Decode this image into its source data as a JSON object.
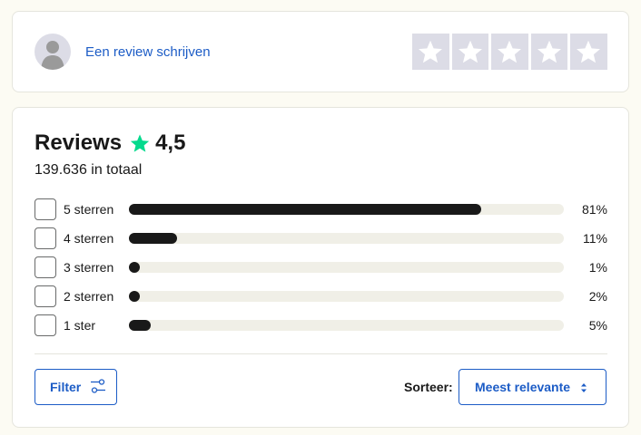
{
  "write_review": {
    "link_text": "Een review schrijven",
    "avatar_icon": "user-avatar-icon",
    "star_icon": "star-icon",
    "star_count": 5,
    "empty_star_bg": "#dcdce6"
  },
  "reviews": {
    "title": "Reviews",
    "rating": "4,5",
    "total_text": "139.636 in totaal",
    "star_color": "#04da8d",
    "distribution": [
      {
        "label": "5 sterren",
        "percent_label": "81%",
        "fraction": 0.81,
        "checked": false
      },
      {
        "label": "4 sterren",
        "percent_label": "11%",
        "fraction": 0.11,
        "checked": false
      },
      {
        "label": "3 sterren",
        "percent_label": "1%",
        "fraction": 0.01,
        "checked": false
      },
      {
        "label": "2 sterren",
        "percent_label": "2%",
        "fraction": 0.02,
        "checked": false
      },
      {
        "label": "1 ster",
        "percent_label": "5%",
        "fraction": 0.05,
        "checked": false
      }
    ]
  },
  "controls": {
    "filter_label": "Filter",
    "filter_icon": "sliders-icon",
    "sort_label": "Sorteer:",
    "sort_value": "Meest relevante",
    "sort_icon": "sort-arrows-icon",
    "accent_color": "#1c5cc6"
  }
}
